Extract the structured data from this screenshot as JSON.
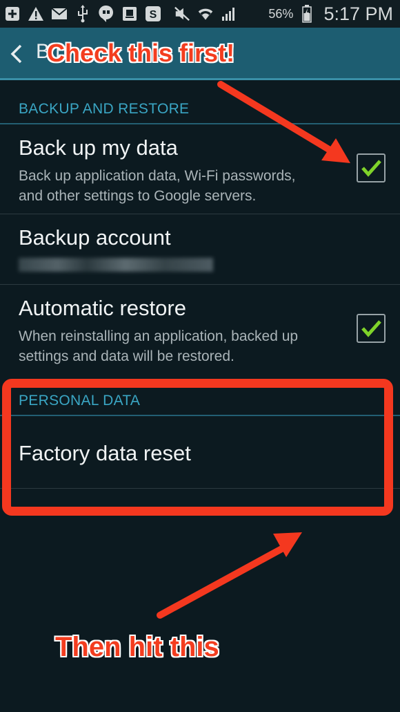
{
  "status_bar": {
    "icons": [
      "add-icon",
      "warning-icon",
      "email-icon",
      "usb-icon",
      "hangouts-icon",
      "notification-icon",
      "skype-icon",
      "mute-icon",
      "wifi-icon",
      "signal-icon",
      "battery-icon"
    ],
    "battery": "56%",
    "time": "5:17 PM"
  },
  "action_bar": {
    "title": "B      p      "
  },
  "sections": {
    "backup": {
      "header": "BACKUP AND RESTORE",
      "back_up_data": {
        "title": "Back up my data",
        "sub_line1": "Back up application data, Wi-Fi passwords,",
        "sub_line2": "and other settings to Google servers.",
        "checked": true
      },
      "backup_account": {
        "title": "Backup account"
      },
      "automatic_restore": {
        "title": "Automatic restore",
        "sub_line1": "When reinstalling an application, backed up",
        "sub_line2": "settings and data will be restored.",
        "checked": true
      }
    },
    "personal": {
      "header": "PERSONAL DATA",
      "factory_reset": {
        "title": "Factory data reset"
      }
    }
  },
  "annotations": {
    "top_text": "Check this first!",
    "bottom_text": "Then hit this",
    "color": "#f33d1f"
  },
  "colors": {
    "accent": "#3aa6c4",
    "action_bar": "#1d5d71",
    "checkmark": "#7fd32a"
  }
}
